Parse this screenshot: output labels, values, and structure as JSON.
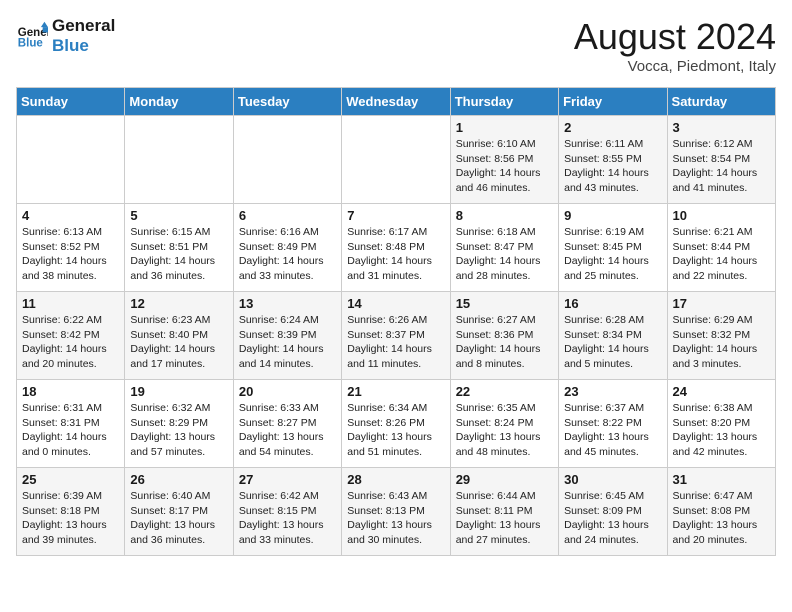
{
  "logo": {
    "line1": "General",
    "line2": "Blue"
  },
  "title": "August 2024",
  "location": "Vocca, Piedmont, Italy",
  "days_of_week": [
    "Sunday",
    "Monday",
    "Tuesday",
    "Wednesday",
    "Thursday",
    "Friday",
    "Saturday"
  ],
  "weeks": [
    [
      {
        "day": "",
        "content": ""
      },
      {
        "day": "",
        "content": ""
      },
      {
        "day": "",
        "content": ""
      },
      {
        "day": "",
        "content": ""
      },
      {
        "day": "1",
        "content": "Sunrise: 6:10 AM\nSunset: 8:56 PM\nDaylight: 14 hours and 46 minutes."
      },
      {
        "day": "2",
        "content": "Sunrise: 6:11 AM\nSunset: 8:55 PM\nDaylight: 14 hours and 43 minutes."
      },
      {
        "day": "3",
        "content": "Sunrise: 6:12 AM\nSunset: 8:54 PM\nDaylight: 14 hours and 41 minutes."
      }
    ],
    [
      {
        "day": "4",
        "content": "Sunrise: 6:13 AM\nSunset: 8:52 PM\nDaylight: 14 hours and 38 minutes."
      },
      {
        "day": "5",
        "content": "Sunrise: 6:15 AM\nSunset: 8:51 PM\nDaylight: 14 hours and 36 minutes."
      },
      {
        "day": "6",
        "content": "Sunrise: 6:16 AM\nSunset: 8:49 PM\nDaylight: 14 hours and 33 minutes."
      },
      {
        "day": "7",
        "content": "Sunrise: 6:17 AM\nSunset: 8:48 PM\nDaylight: 14 hours and 31 minutes."
      },
      {
        "day": "8",
        "content": "Sunrise: 6:18 AM\nSunset: 8:47 PM\nDaylight: 14 hours and 28 minutes."
      },
      {
        "day": "9",
        "content": "Sunrise: 6:19 AM\nSunset: 8:45 PM\nDaylight: 14 hours and 25 minutes."
      },
      {
        "day": "10",
        "content": "Sunrise: 6:21 AM\nSunset: 8:44 PM\nDaylight: 14 hours and 22 minutes."
      }
    ],
    [
      {
        "day": "11",
        "content": "Sunrise: 6:22 AM\nSunset: 8:42 PM\nDaylight: 14 hours and 20 minutes."
      },
      {
        "day": "12",
        "content": "Sunrise: 6:23 AM\nSunset: 8:40 PM\nDaylight: 14 hours and 17 minutes."
      },
      {
        "day": "13",
        "content": "Sunrise: 6:24 AM\nSunset: 8:39 PM\nDaylight: 14 hours and 14 minutes."
      },
      {
        "day": "14",
        "content": "Sunrise: 6:26 AM\nSunset: 8:37 PM\nDaylight: 14 hours and 11 minutes."
      },
      {
        "day": "15",
        "content": "Sunrise: 6:27 AM\nSunset: 8:36 PM\nDaylight: 14 hours and 8 minutes."
      },
      {
        "day": "16",
        "content": "Sunrise: 6:28 AM\nSunset: 8:34 PM\nDaylight: 14 hours and 5 minutes."
      },
      {
        "day": "17",
        "content": "Sunrise: 6:29 AM\nSunset: 8:32 PM\nDaylight: 14 hours and 3 minutes."
      }
    ],
    [
      {
        "day": "18",
        "content": "Sunrise: 6:31 AM\nSunset: 8:31 PM\nDaylight: 14 hours and 0 minutes."
      },
      {
        "day": "19",
        "content": "Sunrise: 6:32 AM\nSunset: 8:29 PM\nDaylight: 13 hours and 57 minutes."
      },
      {
        "day": "20",
        "content": "Sunrise: 6:33 AM\nSunset: 8:27 PM\nDaylight: 13 hours and 54 minutes."
      },
      {
        "day": "21",
        "content": "Sunrise: 6:34 AM\nSunset: 8:26 PM\nDaylight: 13 hours and 51 minutes."
      },
      {
        "day": "22",
        "content": "Sunrise: 6:35 AM\nSunset: 8:24 PM\nDaylight: 13 hours and 48 minutes."
      },
      {
        "day": "23",
        "content": "Sunrise: 6:37 AM\nSunset: 8:22 PM\nDaylight: 13 hours and 45 minutes."
      },
      {
        "day": "24",
        "content": "Sunrise: 6:38 AM\nSunset: 8:20 PM\nDaylight: 13 hours and 42 minutes."
      }
    ],
    [
      {
        "day": "25",
        "content": "Sunrise: 6:39 AM\nSunset: 8:18 PM\nDaylight: 13 hours and 39 minutes."
      },
      {
        "day": "26",
        "content": "Sunrise: 6:40 AM\nSunset: 8:17 PM\nDaylight: 13 hours and 36 minutes."
      },
      {
        "day": "27",
        "content": "Sunrise: 6:42 AM\nSunset: 8:15 PM\nDaylight: 13 hours and 33 minutes."
      },
      {
        "day": "28",
        "content": "Sunrise: 6:43 AM\nSunset: 8:13 PM\nDaylight: 13 hours and 30 minutes."
      },
      {
        "day": "29",
        "content": "Sunrise: 6:44 AM\nSunset: 8:11 PM\nDaylight: 13 hours and 27 minutes."
      },
      {
        "day": "30",
        "content": "Sunrise: 6:45 AM\nSunset: 8:09 PM\nDaylight: 13 hours and 24 minutes."
      },
      {
        "day": "31",
        "content": "Sunrise: 6:47 AM\nSunset: 8:08 PM\nDaylight: 13 hours and 20 minutes."
      }
    ]
  ]
}
